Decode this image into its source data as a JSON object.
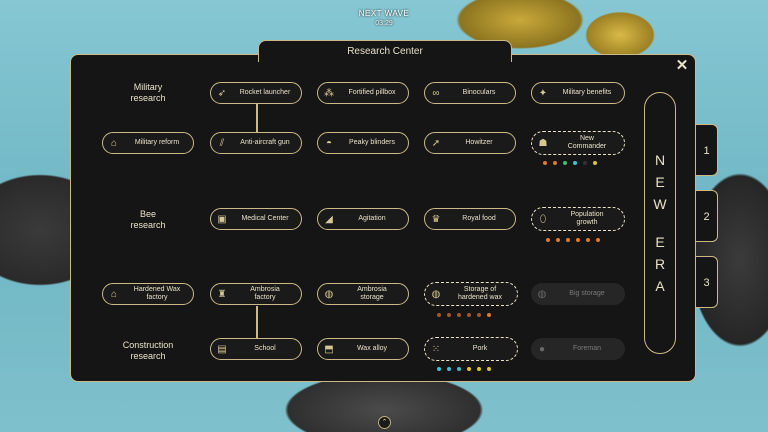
{
  "hud": {
    "wave_label": "NEXT WAVE",
    "timer": "03:29"
  },
  "title": "Research Center",
  "era": {
    "word1": [
      "N",
      "E",
      "W"
    ],
    "word2": [
      "E",
      "R",
      "A"
    ]
  },
  "tabs": [
    "1",
    "2",
    "3"
  ],
  "categories": {
    "military": [
      "Military",
      "research"
    ],
    "bee": [
      "Bee",
      "research"
    ],
    "construction": [
      "Construction",
      "research"
    ]
  },
  "nodes": {
    "rocket_launcher": "Rocket launcher",
    "fortified_pillbox": "Fortified pillbox",
    "binoculars": "Binoculars",
    "military_benefits": "Military benefits",
    "military_reform": "Military reform",
    "anti_aircraft_gun": "Anti-aircraft gun",
    "peaky_blinders": "Peaky blinders",
    "howitzer": "Howitzer",
    "new_commander": [
      "New",
      "Commander"
    ],
    "medical_center": "Medical Center",
    "agitation": "Agitation",
    "royal_food": "Royal food",
    "population_growth": [
      "Population",
      "growth"
    ],
    "hardened_wax_factory": [
      "Hardened Wax",
      "factory"
    ],
    "ambrosia_factory": [
      "Ambrosia",
      "factory"
    ],
    "ambrosia_storage": [
      "Ambrosia",
      "storage"
    ],
    "storage_hardened_wax": [
      "Storage of",
      "hardened wax"
    ],
    "big_storage": "Big storage",
    "school": "School",
    "wax_alloy": "Wax alloy",
    "pork": "Pork",
    "foreman": "Foreman"
  },
  "cost_dots": {
    "new_commander": [
      "#e0792b",
      "#e0792b",
      "#3ec06a",
      "#3ec0d8",
      "#333333",
      "#e0c23a"
    ],
    "population_growth": [
      "#e0792b",
      "#e0792b",
      "#e0792b",
      "#e0792b",
      "#e0792b",
      "#e0792b"
    ],
    "storage_hardened_wax": [
      "#a0562a",
      "#a0562a",
      "#a0562a",
      "#a0562a",
      "#a0562a",
      "#e0792b"
    ],
    "pork": [
      "#3ec0d8",
      "#3ec0d8",
      "#3ec0d8",
      "#e0c23a",
      "#e0c23a",
      "#e0c23a"
    ]
  },
  "icons": {
    "close": "close-icon",
    "rocket": "rocket-icon",
    "pillbox": "pillbox-icon",
    "binoculars": "binoculars-icon",
    "benefits": "benefits-icon",
    "reform": "tent-icon",
    "aa_gun": "aa-gun-icon",
    "hat": "hat-icon",
    "howitzer": "howitzer-icon",
    "commander": "commander-icon",
    "medical": "medical-icon",
    "agitation": "megaphone-icon",
    "crown": "crown-icon",
    "egg": "egg-icon",
    "factory": "factory-icon",
    "storage": "barrel-icon",
    "book": "book-icon",
    "alloy": "ingot-icon",
    "pork": "pork-icon",
    "foreman": "foreman-icon",
    "chevron_up": "chevron-up-icon"
  }
}
